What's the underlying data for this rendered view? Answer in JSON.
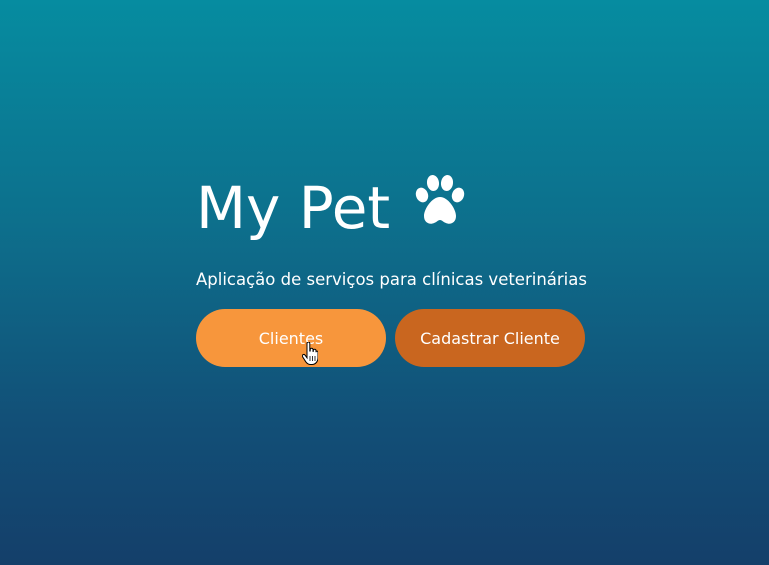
{
  "app": {
    "title": "My Pet",
    "subtitle": "Aplicação de serviços para clínicas veterinárias",
    "logo_icon": "paw-icon"
  },
  "actions": {
    "clients_label": "Clientes",
    "register_client_label": "Cadastrar Cliente"
  },
  "colors": {
    "primary_button": "#f7963c",
    "secondary_button": "#c9661f",
    "background_top": "#068ca0",
    "background_bottom": "#143f6a"
  },
  "cursor": {
    "icon": "hand-pointer-icon"
  }
}
